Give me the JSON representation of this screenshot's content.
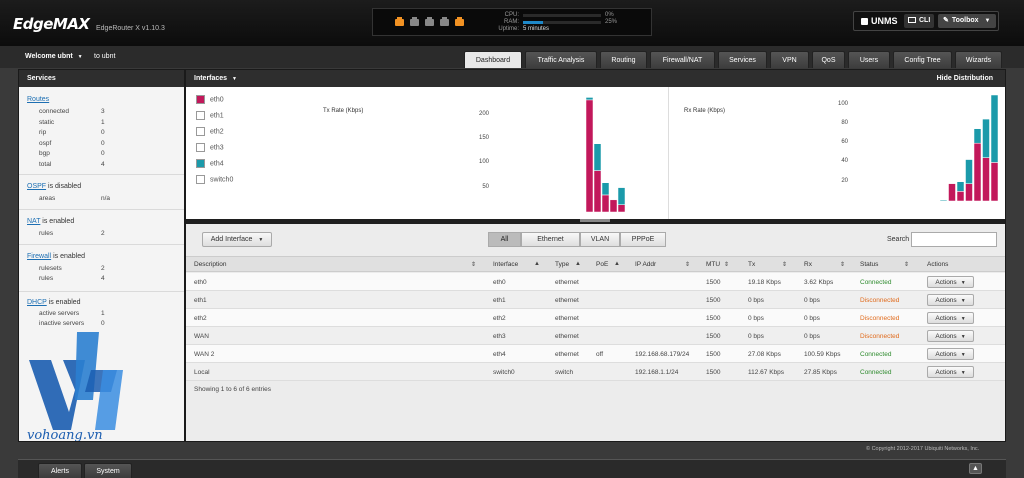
{
  "header": {
    "logo": "EdgeMAX",
    "device": "EdgeRouter X v1.10.3",
    "status": {
      "cpu_label": "CPU:",
      "cpu_value": "0%",
      "cpu_fraction": 0.0,
      "ram_label": "RAM:",
      "ram_value": "25%",
      "ram_fraction": 0.25,
      "uptime_label": "Uptime:",
      "uptime_value": "5 minutes",
      "ports": [
        {
          "name": "eth0",
          "color": "#f29223"
        },
        {
          "name": "eth1",
          "color": "#888888"
        },
        {
          "name": "eth2",
          "color": "#888888"
        },
        {
          "name": "eth3",
          "color": "#888888"
        },
        {
          "name": "eth4",
          "color": "#f29223"
        }
      ]
    },
    "unms_label": "UNMS",
    "cli_label": "CLI",
    "toolbox_label": "Toolbox"
  },
  "subbar": {
    "welcome": "Welcome ubnt",
    "user_link": "to ubnt"
  },
  "nav": {
    "tabs": [
      {
        "label": "Dashboard",
        "active": true
      },
      {
        "label": "Traffic Analysis"
      },
      {
        "label": "Routing"
      },
      {
        "label": "Firewall/NAT"
      },
      {
        "label": "Services"
      },
      {
        "label": "VPN"
      },
      {
        "label": "QoS"
      },
      {
        "label": "Users"
      },
      {
        "label": "Config Tree"
      },
      {
        "label": "Wizards"
      }
    ]
  },
  "services": {
    "title": "Services",
    "routes": {
      "title": "Routes",
      "rows": [
        {
          "label": "connected",
          "value": "3"
        },
        {
          "label": "static",
          "value": "1"
        },
        {
          "label": "rip",
          "value": "0"
        },
        {
          "label": "ospf",
          "value": "0"
        },
        {
          "label": "bgp",
          "value": "0"
        },
        {
          "label": "total",
          "value": "4"
        }
      ]
    },
    "ospf": {
      "title": "OSPF",
      "suffix": " is disabled",
      "rows": [
        {
          "label": "areas",
          "value": "n/a"
        }
      ]
    },
    "nat": {
      "title": "NAT",
      "suffix": " is enabled",
      "rows": [
        {
          "label": "rules",
          "value": "2"
        }
      ]
    },
    "firewall": {
      "title": "Firewall",
      "suffix": " is enabled",
      "rows": [
        {
          "label": "rulesets",
          "value": "2"
        },
        {
          "label": "rules",
          "value": "4"
        }
      ]
    },
    "dhcp": {
      "title": "DHCP",
      "suffix": " is enabled",
      "rows": [
        {
          "label": "active servers",
          "value": "1"
        },
        {
          "label": "inactive servers",
          "value": "0"
        }
      ]
    },
    "watermark": "vohoang.vn"
  },
  "interfaces_panel": {
    "title": "Interfaces",
    "hide_distribution": "Hide Distribution",
    "legend": [
      {
        "name": "eth0",
        "color": "#c2185b",
        "checked": true
      },
      {
        "name": "eth1",
        "color": "#ffffff",
        "checked": false
      },
      {
        "name": "eth2",
        "color": "#ffffff",
        "checked": false
      },
      {
        "name": "eth3",
        "color": "#ffffff",
        "checked": false
      },
      {
        "name": "eth4",
        "color": "#1b9aaa",
        "checked": true
      },
      {
        "name": "switch0",
        "color": "#ffffff",
        "checked": false
      }
    ]
  },
  "chart_data": [
    {
      "type": "bar",
      "title": "Tx Rate (Kbps)",
      "stacked": true,
      "yticks": [
        50,
        100,
        150,
        200
      ],
      "ylim": [
        0,
        240
      ],
      "series": [
        {
          "name": "eth0",
          "color": "#c2185b",
          "values": [
            230,
            85,
            35,
            25,
            15
          ]
        },
        {
          "name": "eth4",
          "color": "#1b9aaa",
          "values": [
            5,
            55,
            25,
            0,
            35
          ]
        }
      ]
    },
    {
      "type": "bar",
      "title": "Rx Rate (Kbps)",
      "stacked": true,
      "yticks": [
        20,
        40,
        60,
        80,
        100
      ],
      "ylim": [
        0,
        110
      ],
      "series": [
        {
          "name": "eth0",
          "color": "#c2185b",
          "values": [
            0,
            18,
            10,
            18,
            60,
            45,
            40
          ]
        },
        {
          "name": "eth4",
          "color": "#1b9aaa",
          "values": [
            1,
            0,
            10,
            25,
            15,
            40,
            70
          ]
        }
      ]
    }
  ],
  "table": {
    "add_interface": "Add Interface",
    "filters": [
      {
        "label": "All",
        "active": true
      },
      {
        "label": "Ethernet"
      },
      {
        "label": "VLAN"
      },
      {
        "label": "PPPoE"
      }
    ],
    "search_label": "Search",
    "search_value": "",
    "columns": {
      "description": "Description",
      "interface": "Interface",
      "type": "Type",
      "poe": "PoE",
      "ip": "IP Addr",
      "mtu": "MTU",
      "tx": "Tx",
      "rx": "Rx",
      "status": "Status",
      "actions": "Actions"
    },
    "rows": [
      {
        "description": "eth0",
        "interface": "eth0",
        "type": "ethernet",
        "poe": "",
        "ip": "",
        "mtu": "1500",
        "tx": "19.18 Kbps",
        "rx": "3.62 Kbps",
        "status": "Connected",
        "status_color": "#2e8b2e",
        "action": "Actions"
      },
      {
        "description": "eth1",
        "interface": "eth1",
        "type": "ethernet",
        "poe": "",
        "ip": "",
        "mtu": "1500",
        "tx": "0 bps",
        "rx": "0 bps",
        "status": "Disconnected",
        "status_color": "#e06a1b",
        "action": "Actions"
      },
      {
        "description": "eth2",
        "interface": "eth2",
        "type": "ethernet",
        "poe": "",
        "ip": "",
        "mtu": "1500",
        "tx": "0 bps",
        "rx": "0 bps",
        "status": "Disconnected",
        "status_color": "#e06a1b",
        "action": "Actions"
      },
      {
        "description": "WAN",
        "interface": "eth3",
        "type": "ethernet",
        "poe": "",
        "ip": "",
        "mtu": "1500",
        "tx": "0 bps",
        "rx": "0 bps",
        "status": "Disconnected",
        "status_color": "#e06a1b",
        "action": "Actions"
      },
      {
        "description": "WAN 2",
        "interface": "eth4",
        "type": "ethernet",
        "poe": "off",
        "ip": "192.168.68.179/24",
        "mtu": "1500",
        "tx": "27.08 Kbps",
        "rx": "100.59 Kbps",
        "status": "Connected",
        "status_color": "#2e8b2e",
        "action": "Actions"
      },
      {
        "description": "Local",
        "interface": "switch0",
        "type": "switch",
        "poe": "",
        "ip": "192.168.1.1/24",
        "mtu": "1500",
        "tx": "112.67 Kbps",
        "rx": "27.85 Kbps",
        "status": "Connected",
        "status_color": "#2e8b2e",
        "action": "Actions"
      }
    ],
    "showing": "Showing 1 to 6 of 6 entries"
  },
  "footer": {
    "copyright": "© Copyright 2012-2017 Ubiquiti Networks, Inc.",
    "tabs": [
      "Alerts",
      "System"
    ],
    "collapse_glyph": "▲"
  }
}
